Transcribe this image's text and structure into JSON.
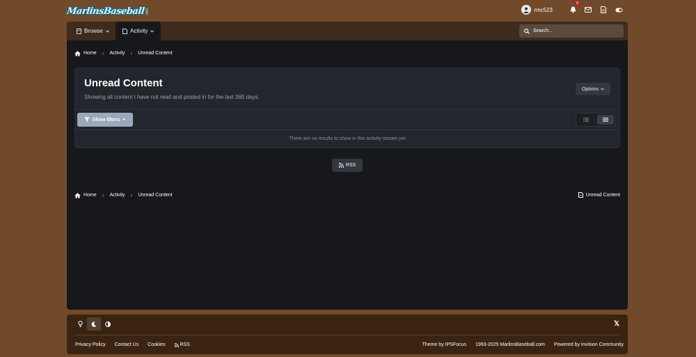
{
  "site": {
    "logo_text": "MarlinsBaseball"
  },
  "user": {
    "name": "rmc523",
    "notification_count": "8"
  },
  "nav": {
    "browse_label": "Browse",
    "activity_label": "Activity",
    "search_placeholder": "Search..."
  },
  "breadcrumb": {
    "home": "Home",
    "activity": "Activity",
    "current": "Unread Content"
  },
  "page": {
    "title": "Unread Content",
    "subtitle": "Showing all content I have not read and posted in for the last 365 days.",
    "options_label": "Options",
    "show_filters_label": "Show filters",
    "empty_message": "There are no results to show in this activity stream yet",
    "rss_label": "RSS",
    "unread_link": "Unread Content"
  },
  "footer": {
    "links": [
      "Privacy Policy",
      "Contact Us",
      "Cookies",
      "RSS"
    ],
    "theme_credit": "Theme by IPSFocus",
    "copyright": "1993-2025 MarlinsBaseball.com",
    "powered_by": "Powered by Invision Community"
  },
  "colors": {
    "background": "#704a2b",
    "panel": "#16181c",
    "nav": "#3f2b1c",
    "footer": "#3a2411",
    "filter_button": "#9ba9bc",
    "badge": "#d4161c"
  }
}
